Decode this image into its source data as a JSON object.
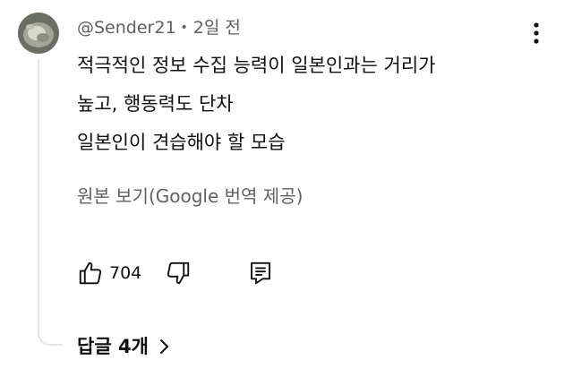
{
  "comment": {
    "author": "@Sender21",
    "separator": "•",
    "time": "2일 전",
    "lines": [
      "적극적인 정보 수집 능력이 일본인과는 거리가",
      "높고, 행동력도 단차",
      "일본인이 견습해야 할 모습"
    ],
    "translate_label": "원본 보기(Google 번역 제공)",
    "like_count": "704",
    "replies_label": "답글 4개"
  },
  "icons": {
    "more": "more-vert-icon",
    "like": "thumbs-up-icon",
    "dislike": "thumbs-down-icon",
    "reply": "comment-reply-icon",
    "replies_chevron": "chevron-right-icon"
  },
  "colors": {
    "text_primary": "#0f0f0f",
    "text_secondary": "#606060",
    "thread_line": "#e5e5e5"
  }
}
